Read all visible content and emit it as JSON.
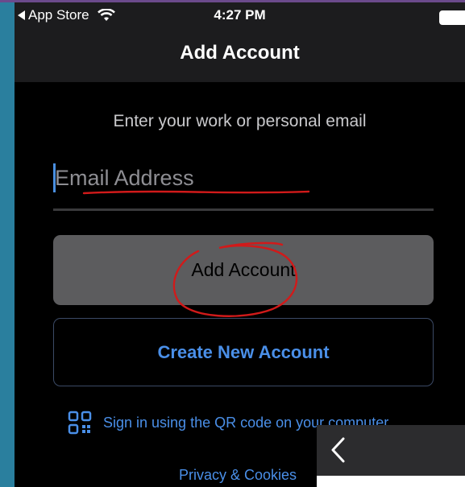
{
  "status_bar": {
    "back_app": "App Store",
    "time": "4:27 PM",
    "icons": [
      "back-triangle-icon",
      "wifi-icon",
      "battery-icon"
    ]
  },
  "nav": {
    "title": "Add Account"
  },
  "form": {
    "prompt": "Enter your work or personal email",
    "email_value": "",
    "email_placeholder": "Email Address",
    "add_account_label": "Add Account",
    "create_account_label": "Create New Account"
  },
  "qr": {
    "icon": "qr-code-icon",
    "text": "Sign in using the QR code on your computer"
  },
  "footer": {
    "privacy_label": "Privacy & Cookies"
  },
  "overlay": {
    "icon": "chevron-left-icon"
  },
  "colors": {
    "background": "#000000",
    "bar": "#1c1c1e",
    "accent": "#4a8fe8",
    "button_gray": "#5c5c5e",
    "annotation_red": "#d11a1a"
  }
}
